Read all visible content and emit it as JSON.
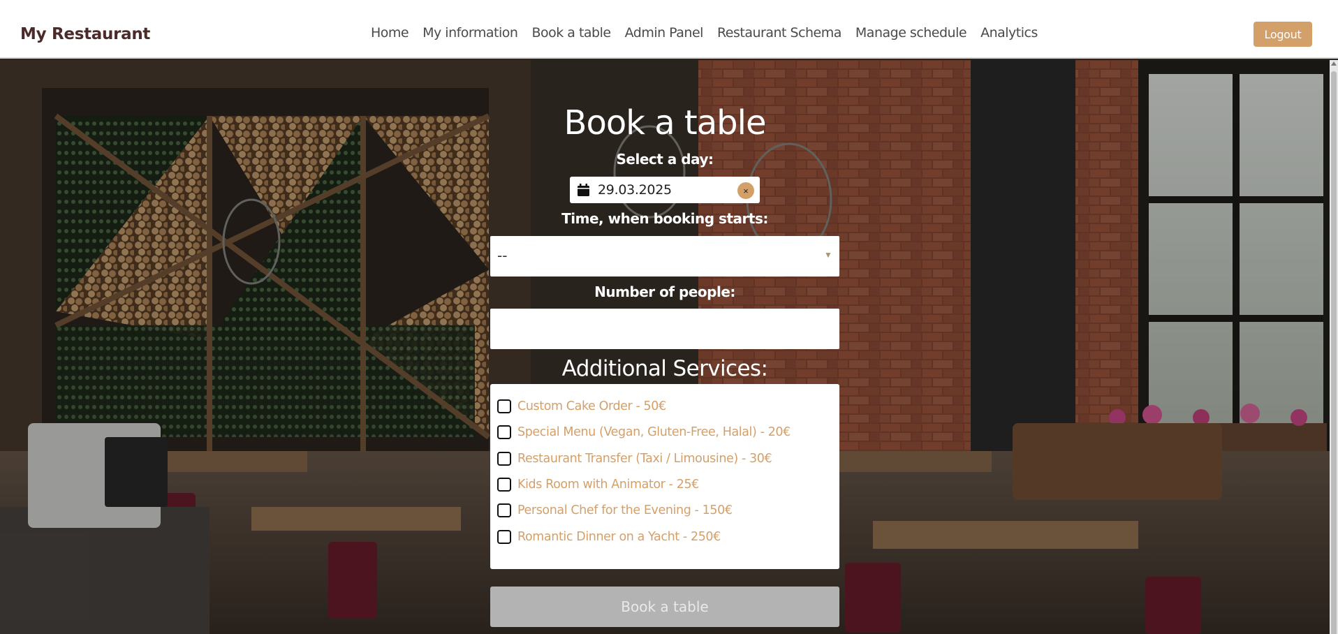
{
  "header": {
    "brand": "My Restaurant",
    "nav": [
      "Home",
      "My information",
      "Book a table",
      "Admin Panel",
      "Restaurant Schema",
      "Manage schedule",
      "Analytics"
    ],
    "logout_label": "Logout"
  },
  "form": {
    "title": "Book a table",
    "day_label": "Select a day:",
    "date_value": "29.03.2025",
    "clear_symbol": "×",
    "time_label": "Time, when booking starts:",
    "time_value": "--",
    "people_label": "Number of people:",
    "people_value": "",
    "services_title": "Additional Services:",
    "services": [
      "Custom Cake Order - 50€",
      "Special Menu (Vegan, Gluten-Free, Halal) - 20€",
      "Restaurant Transfer (Taxi / Limousine) - 30€",
      "Kids Room with Animator - 25€",
      "Personal Chef for the Evening - 150€",
      "Romantic Dinner on a Yacht - 250€"
    ],
    "submit_label": "Book a table"
  },
  "icons": {
    "calendar": "calendar-icon",
    "clear": "clear-date-icon",
    "caret": "chevron-down-icon"
  },
  "colors": {
    "accent": "#d4a06a",
    "brand_text": "#4a2a2a",
    "disabled_button": "#b3b3b3"
  }
}
